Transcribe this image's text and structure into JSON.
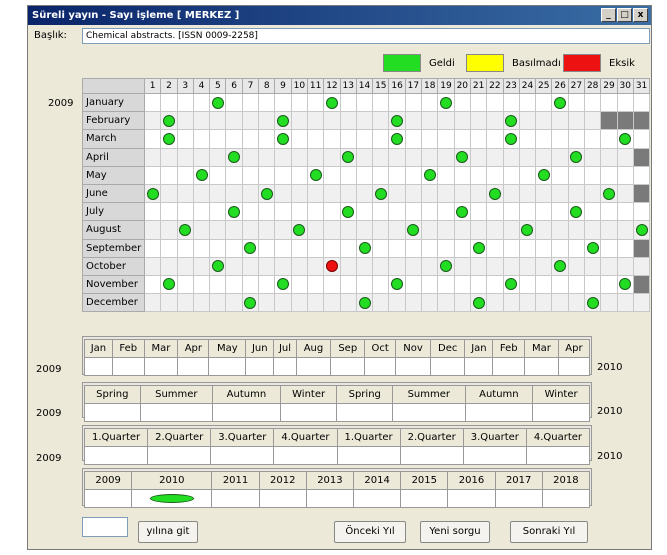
{
  "window": {
    "title": "Süreli yayın - Sayı işleme [ MERKEZ ]",
    "btn_min": "_",
    "btn_max": "□",
    "btn_close": "x"
  },
  "baslik": {
    "label": "Başlık:",
    "value": "Chemical abstracts. [ISSN 0009-2258]"
  },
  "legend": [
    {
      "label": "Geldi",
      "color": "#22dd22"
    },
    {
      "label": "Basılmadı",
      "color": "#ffff00"
    },
    {
      "label": "Eksik",
      "color": "#ee1111"
    }
  ],
  "year": "2009",
  "days": [
    "1",
    "2",
    "3",
    "4",
    "5",
    "6",
    "7",
    "8",
    "9",
    "10",
    "11",
    "12",
    "13",
    "14",
    "15",
    "16",
    "17",
    "18",
    "19",
    "20",
    "21",
    "22",
    "23",
    "24",
    "25",
    "26",
    "27",
    "28",
    "29",
    "30",
    "31"
  ],
  "months": [
    {
      "name": "January",
      "received": [
        5,
        12,
        19,
        26
      ],
      "missing": [],
      "na": []
    },
    {
      "name": "February",
      "received": [
        2,
        9,
        16,
        23
      ],
      "missing": [],
      "na": [
        29,
        30,
        31
      ]
    },
    {
      "name": "March",
      "received": [
        2,
        9,
        16,
        23,
        30
      ],
      "missing": [],
      "na": []
    },
    {
      "name": "April",
      "received": [
        6,
        13,
        20,
        27
      ],
      "missing": [],
      "na": [
        31
      ]
    },
    {
      "name": "May",
      "received": [
        4,
        11,
        18,
        25
      ],
      "missing": [],
      "na": []
    },
    {
      "name": "June",
      "received": [
        1,
        8,
        15,
        22,
        29
      ],
      "missing": [],
      "na": [
        31
      ]
    },
    {
      "name": "July",
      "received": [
        6,
        13,
        20,
        27
      ],
      "missing": [],
      "na": []
    },
    {
      "name": "August",
      "received": [
        3,
        10,
        17,
        24,
        31
      ],
      "missing": [],
      "na": []
    },
    {
      "name": "September",
      "received": [
        7,
        14,
        21,
        28
      ],
      "missing": [],
      "na": [
        31
      ]
    },
    {
      "name": "October",
      "received": [
        5,
        19,
        26
      ],
      "missing": [
        12
      ],
      "na": []
    },
    {
      "name": "November",
      "received": [
        2,
        9,
        16,
        23,
        30
      ],
      "missing": [],
      "na": [
        31
      ]
    },
    {
      "name": "December",
      "received": [
        7,
        14,
        21,
        28
      ],
      "missing": [],
      "na": []
    }
  ],
  "monthly_row": {
    "start_year": "2009",
    "end_year": "2010",
    "labels": [
      "Jan",
      "Feb",
      "Mar",
      "Apr",
      "May",
      "Jun",
      "Jul",
      "Aug",
      "Sep",
      "Oct",
      "Nov",
      "Dec",
      "Jan",
      "Feb",
      "Mar",
      "Apr"
    ]
  },
  "season_row": {
    "start_year": "2009",
    "end_year": "2010",
    "labels": [
      "Spring",
      "Summer",
      "Autumn",
      "Winter",
      "Spring",
      "Summer",
      "Autumn",
      "Winter"
    ]
  },
  "quarter_row": {
    "start_year": "2009",
    "end_year": "2010",
    "labels": [
      "1.Quarter",
      "2.Quarter",
      "3.Quarter",
      "4.Quarter",
      "1.Quarter",
      "2.Quarter",
      "3.Quarter",
      "4.Quarter"
    ]
  },
  "year_row": {
    "labels": [
      "2009",
      "2010",
      "2011",
      "2012",
      "2013",
      "2014",
      "2015",
      "2016",
      "2017",
      "2018"
    ],
    "received_index": 1
  },
  "buttons": {
    "go_year": "yılına git",
    "prev": "Önceki Yıl",
    "new": "Yeni sorgu",
    "next": "Sonraki Yıl"
  },
  "go_year_input": ""
}
